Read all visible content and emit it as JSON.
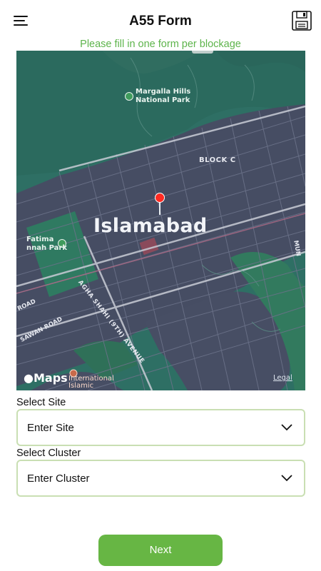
{
  "header": {
    "title": "A55 Form",
    "menu_icon": "hamburger-menu-icon",
    "save_icon": "floppy-disk-save-icon"
  },
  "subtitle": "Please fill in one form per blockage",
  "map": {
    "city_label": "Islamabad",
    "park_top": [
      "Margalla Hills",
      "National Park"
    ],
    "park_left": [
      "Fatima",
      "nnah Park"
    ],
    "block_label": "BLOCK C",
    "avenue_label": "AGHA SHAHI (9TH) AVENUE",
    "sawan_label": "SAWAN ROAD",
    "road_left_label": "ROAD",
    "mun_label": "MUN",
    "poi_label": [
      "International",
      "Islamic"
    ],
    "brand": "Maps",
    "legal": "Legal",
    "pin_icon": "location-pin-icon"
  },
  "form": {
    "site_label": "Select Site",
    "site_value": "Enter Site",
    "cluster_label": "Select Cluster",
    "cluster_value": "Enter Cluster"
  },
  "actions": {
    "next_label": "Next"
  },
  "colors": {
    "accent": "#67b644",
    "subtitle": "#5db44b",
    "field_border": "#c9dfb3",
    "map_green": "#2e6f64",
    "map_urban": "#464d63",
    "pin": "#ff2a22"
  }
}
